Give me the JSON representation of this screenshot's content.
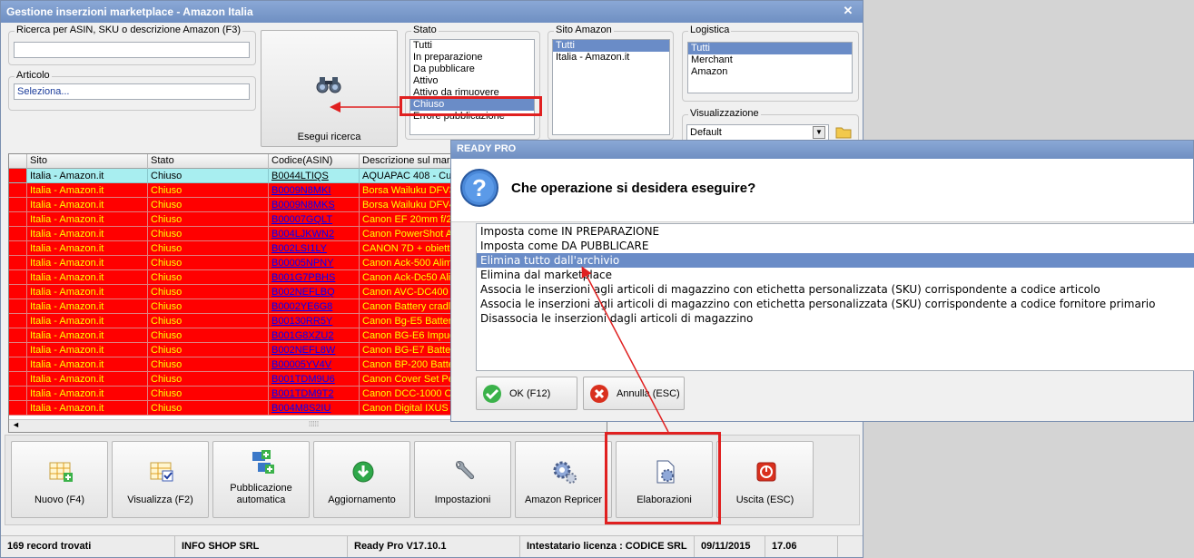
{
  "window": {
    "title": "Gestione inserzioni marketplace - Amazon Italia",
    "close_glyph": "✕"
  },
  "search": {
    "label": "Ricerca per ASIN, SKU o descrizione Amazon (F3)",
    "value": ""
  },
  "articolo": {
    "label": "Articolo",
    "value": "Seleziona..."
  },
  "search_button": {
    "label": "Esegui ricerca",
    "icon": "binoculars-icon"
  },
  "stato": {
    "label": "Stato",
    "items": [
      "Tutti",
      "In preparazione",
      "Da pubblicare",
      "Attivo",
      "Attivo da rimuovere",
      "Chiuso",
      "Errore pubblicazione"
    ],
    "selected": "Chiuso"
  },
  "sito": {
    "label": "Sito Amazon",
    "items": [
      "Tutti",
      "Italia - Amazon.it"
    ],
    "selected": "Tutti"
  },
  "logistica": {
    "label": "Logistica",
    "items": [
      "Tutti",
      "Merchant",
      "Amazon"
    ],
    "selected": "Tutti"
  },
  "visualizzazione": {
    "label": "Visualizzazione",
    "value": "Default"
  },
  "grid": {
    "columns": [
      "Sito",
      "Stato",
      "Codice(ASIN)",
      "Descrizione sul marke"
    ],
    "rows": [
      {
        "sito": "Italia - Amazon.it",
        "stato": "Chiuso",
        "code": "B0044LTIQS",
        "desc": "AQUAPAC 408 - Cus",
        "style": "cyan"
      },
      {
        "sito": "Italia - Amazon.it",
        "stato": "Chiuso",
        "code": "B0009N8MKI",
        "desc": "Borsa Wailuku DFV35",
        "style": "red"
      },
      {
        "sito": "Italia - Amazon.it",
        "stato": "Chiuso",
        "code": "B0009N8MKS",
        "desc": "Borsa Wailuku DFV40",
        "style": "red"
      },
      {
        "sito": "Italia - Amazon.it",
        "stato": "Chiuso",
        "code": "B00007GQLT",
        "desc": "Canon  EF 20mm f/2",
        "style": "red"
      },
      {
        "sito": "Italia - Amazon.it",
        "stato": "Chiuso",
        "code": "B004LJKWN2",
        "desc": "Canon  PowerShot A",
        "style": "red"
      },
      {
        "sito": "Italia - Amazon.it",
        "stato": "Chiuso",
        "code": "B002LSI1LY",
        "desc": "CANON 7D + obietti",
        "style": "red"
      },
      {
        "sito": "Italia - Amazon.it",
        "stato": "Chiuso",
        "code": "B00005NPNY",
        "desc": "Canon Ack-500 Alime",
        "style": "red"
      },
      {
        "sito": "Italia - Amazon.it",
        "stato": "Chiuso",
        "code": "B001G7PBHS",
        "desc": "Canon Ack-Dc50 Alim",
        "style": "red"
      },
      {
        "sito": "Italia - Amazon.it",
        "stato": "Chiuso",
        "code": "B002NEFLBQ",
        "desc": "Canon AVC-DC400 S",
        "style": "red"
      },
      {
        "sito": "Italia - Amazon.it",
        "stato": "Chiuso",
        "code": "B0002YE6G8",
        "desc": "Canon Battery cradl",
        "style": "red"
      },
      {
        "sito": "Italia - Amazon.it",
        "stato": "Chiuso",
        "code": "B00130RR5Y",
        "desc": "Canon Bg-E5 Battery",
        "style": "red"
      },
      {
        "sito": "Italia - Amazon.it",
        "stato": "Chiuso",
        "code": "B001G8XZU2",
        "desc": "Canon BG-E6 Impugi",
        "style": "red"
      },
      {
        "sito": "Italia - Amazon.it",
        "stato": "Chiuso",
        "code": "B002NEFL8W",
        "desc": "Canon BG-E7 Batter",
        "style": "red"
      },
      {
        "sito": "Italia - Amazon.it",
        "stato": "Chiuso",
        "code": "B00005YV4V",
        "desc": "Canon BP-200 Batte",
        "style": "red"
      },
      {
        "sito": "Italia - Amazon.it",
        "stato": "Chiuso",
        "code": "B001TDM9U6",
        "desc": "Canon Cover Set Pe",
        "style": "red"
      },
      {
        "sito": "Italia - Amazon.it",
        "stato": "Chiuso",
        "code": "B001TDM9T2",
        "desc": "Canon DCC-1000 Cu",
        "style": "red"
      },
      {
        "sito": "Italia - Amazon.it",
        "stato": "Chiuso",
        "code": "B004M8S2IU",
        "desc": "Canon Digital IXUS 1",
        "style": "red"
      }
    ]
  },
  "toolbar": {
    "buttons": [
      {
        "label": "Nuovo (F4)",
        "icon": "new-grid-icon"
      },
      {
        "label": "Visualizza (F2)",
        "icon": "view-grid-icon"
      },
      {
        "label": "Pubblicazione automatica",
        "icon": "publish-icon"
      },
      {
        "label": "Aggiornamento",
        "icon": "update-icon"
      },
      {
        "label": "Impostazioni",
        "icon": "wrench-icon"
      },
      {
        "label": "Amazon Repricer",
        "icon": "gears-icon"
      },
      {
        "label": "Elaborazioni",
        "icon": "document-gear-icon"
      },
      {
        "label": "Uscita (ESC)",
        "icon": "power-icon"
      }
    ]
  },
  "status": {
    "records": "169 record trovati",
    "company": "INFO SHOP SRL",
    "version": "Ready Pro V17.10.1",
    "license": "Intestatario licenza : CODICE SRL",
    "date": "09/11/2015",
    "time": "17.06"
  },
  "dialog": {
    "title": "READY PRO",
    "question": "Che operazione si desidera eseguire?",
    "options": [
      "Imposta come IN PREPARAZIONE",
      "Imposta come DA PUBBLICARE",
      "Elimina tutto dall'archivio",
      "Elimina dal marketplace",
      "Associa le inserzioni agli articoli di magazzino con etichetta personalizzata (SKU) corrispondente a codice articolo",
      "Associa le inserzioni agli articoli di magazzino con etichetta personalizzata (SKU) corrispondente a codice fornitore primario",
      "Disassocia le inserzioni dagli articoli di magazzino"
    ],
    "selected": "Elimina tutto dall'archivio",
    "ok_label": "OK (F12)",
    "cancel_label": "Annulla (ESC)"
  },
  "colors": {
    "row_red": "#ff0000",
    "row_text": "#ffff00",
    "highlight": "#e02020",
    "selection": "#6a8cc7"
  }
}
